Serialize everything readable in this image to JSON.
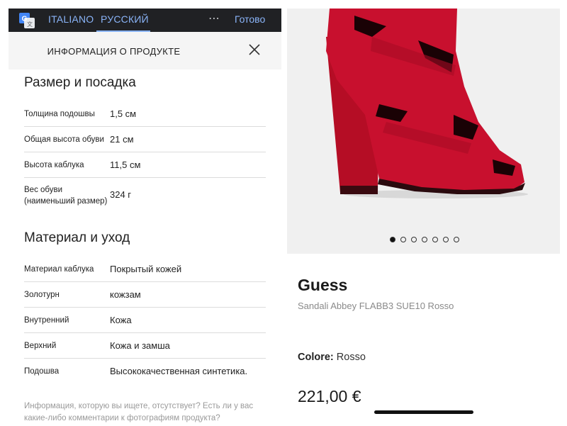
{
  "translate_bar": {
    "languages": [
      "ITALIANO",
      "РУССКИЙ"
    ],
    "active_language": "РУССКИЙ",
    "more_label": "⋯",
    "done_label": "Готово",
    "accent_color": "#8ab4f8",
    "background_color": "#202124"
  },
  "info_panel": {
    "title": "ИНФОРМАЦИЯ О ПРОДУКТЕ",
    "close_icon": "close-icon",
    "size_section": {
      "title": "Размер и посадка",
      "rows": [
        {
          "label": "Толщина подошвы",
          "value": "1,5 см"
        },
        {
          "label": "Общая высота обуви",
          "value": "21 см"
        },
        {
          "label": "Высота каблука",
          "value": "11,5 см"
        },
        {
          "label": "Вес обуви\n(наименьший размер)",
          "value": "324 г"
        }
      ]
    },
    "material_section": {
      "title": "Материал и уход",
      "rows": [
        {
          "label": "Материал каблука",
          "value": "Покрытый кожей"
        },
        {
          "label": "Золотурн",
          "value": "кожзам"
        },
        {
          "label": "Внутренний",
          "value": "Кожа"
        },
        {
          "label": "Верхний",
          "value": "Кожа и замша"
        },
        {
          "label": "Подошва",
          "value": "Высококачественная синтетика."
        }
      ]
    },
    "footnote": "Информация, которую вы ищете, отсутствует? Есть ли у вас какие-либо комментарии к фотографиям продукта? Сообщите"
  },
  "product": {
    "image_icon": "red-suede-heel-sandal-image",
    "carousel_total": 7,
    "carousel_active": 1,
    "brand": "Guess",
    "model": "Sandali Abbey FLABB3 SUE10 Rosso",
    "color_label": "Colore:",
    "color_value": "Rosso",
    "price": "221,00 €",
    "shoe_color": "#c8102e"
  }
}
